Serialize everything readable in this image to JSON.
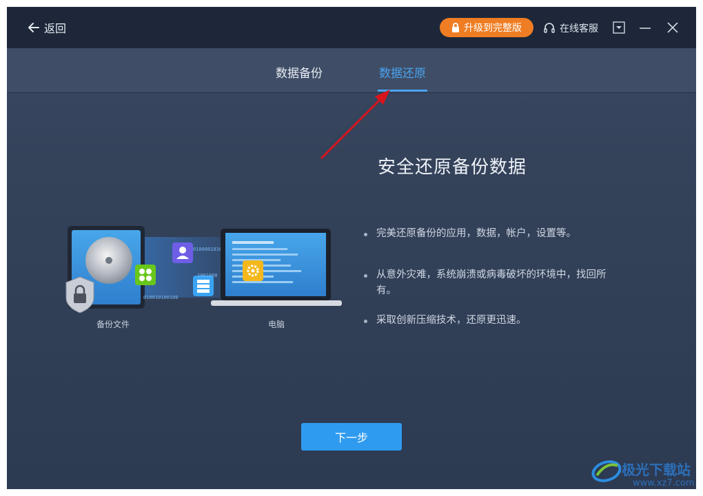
{
  "titlebar": {
    "back_label": "返回",
    "upgrade_label": "升级到完整版",
    "service_label": "在线客服"
  },
  "tabs": [
    {
      "label": "数据备份",
      "active": false
    },
    {
      "label": "数据还原",
      "active": true
    }
  ],
  "main": {
    "heading": "安全还原备份数据",
    "bullets": [
      "完美还原备份的应用，数据，帐户，设置等。",
      "从意外灾难，系统崩溃或病毒破坏的环境中，找回所有。",
      "采取创新压缩技术，还原更迅速。"
    ],
    "illustration": {
      "backup_label": "备份文件",
      "computer_label": "电脑",
      "binary_texts": [
        "0100001010",
        "1001000",
        "010010100100"
      ]
    },
    "next_label": "下一步"
  },
  "watermark": {
    "title": "极光下载站",
    "url": "www.xz7.com"
  },
  "colors": {
    "titlebar_bg": "#1d2739",
    "window_bg": "#34425a",
    "accent_blue": "#4aa3f0",
    "upgrade_orange": "#ef7d23",
    "button_blue": "#2f9bf0",
    "arrow_red": "#d8141c"
  },
  "icons": [
    "back-arrow-icon",
    "lock-icon",
    "headset-icon",
    "dropdown-icon",
    "minimize-icon",
    "close-icon"
  ]
}
